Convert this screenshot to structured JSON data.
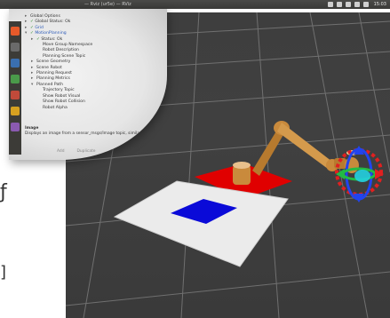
{
  "window": {
    "title": "— Rviz (ur5e) — RViz",
    "clock": "15:03"
  },
  "displays_panel": {
    "items": [
      {
        "label": "Global Options",
        "arrow": "▸",
        "indent": 0
      },
      {
        "label": "Global Status: Ok",
        "arrow": "▸",
        "check": "✓",
        "indent": 0
      },
      {
        "label": "Grid",
        "arrow": "▸",
        "check": "✓",
        "indent": 0,
        "blue": true
      },
      {
        "label": "MotionPlanning",
        "arrow": "▾",
        "check": "✓",
        "indent": 0,
        "blue": true
      },
      {
        "label": "Status: Ok",
        "arrow": "▸",
        "check": "✓",
        "indent": 1
      },
      {
        "label": "Move Group Namespace",
        "indent": 2
      },
      {
        "label": "Robot Description",
        "indent": 2
      },
      {
        "label": "Planning Scene Topic",
        "indent": 2
      },
      {
        "label": "Scene Geometry",
        "arrow": "▸",
        "indent": 1
      },
      {
        "label": "Scene Robot",
        "arrow": "▸",
        "indent": 1
      },
      {
        "label": "Planning Request",
        "arrow": "▸",
        "indent": 1
      },
      {
        "label": "Planning Metrics",
        "arrow": "▸",
        "indent": 1
      },
      {
        "label": "Planned Path",
        "arrow": "▾",
        "indent": 1
      },
      {
        "label": "Trajectory Topic",
        "indent": 2
      },
      {
        "label": "Show Robot Visual",
        "indent": 2
      },
      {
        "label": "Show Robot Collision",
        "indent": 2
      },
      {
        "label": "Robot Alpha",
        "indent": 2
      }
    ],
    "description_title": "Image",
    "description_text": "Displays an image from a sensor_msgs/Image topic, similar",
    "buttons": [
      "Add",
      "Duplicate"
    ]
  },
  "scene": {
    "floor_color": "#3d3d3d",
    "grid_color": "#8a8a8a",
    "table_color": "#ececec",
    "target_color": "#0a0ad8",
    "base_color": "#e00000",
    "robot_color": "#c98a3c",
    "gizmo_ring_color": "#e02020"
  }
}
